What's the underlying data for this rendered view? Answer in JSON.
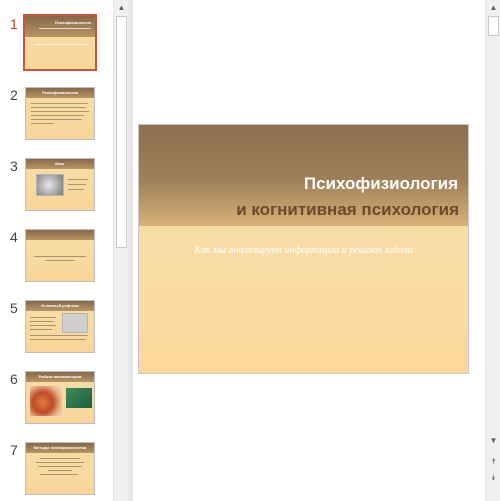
{
  "slides": [
    {
      "number": "1",
      "title": "Психофизиология",
      "subtitle": "Как мы анализируем информацию"
    },
    {
      "number": "2",
      "title": "Психофизиология"
    },
    {
      "number": "3",
      "title": "Мозг"
    },
    {
      "number": "4",
      "title": ""
    },
    {
      "number": "5",
      "title": "Условный рефлекс"
    },
    {
      "number": "6",
      "title": "Работа анализаторов"
    },
    {
      "number": "7",
      "title": "Методы психофизиологии"
    }
  ],
  "current_slide": {
    "title_line1": "Психофизиология",
    "title_line2": "и когнитивная психология",
    "subtitle": "Как мы анализируем информацию и решаем задачи"
  },
  "scroll": {
    "up": "▲",
    "down": "▼",
    "prev_slide": "⯭",
    "next_slide": "⯯"
  },
  "colors": {
    "selected_border": "#c5553a",
    "band_dark": "#8d6e4e",
    "slide_bg": "#f8dca6",
    "title_dark": "#6b4a2e"
  }
}
